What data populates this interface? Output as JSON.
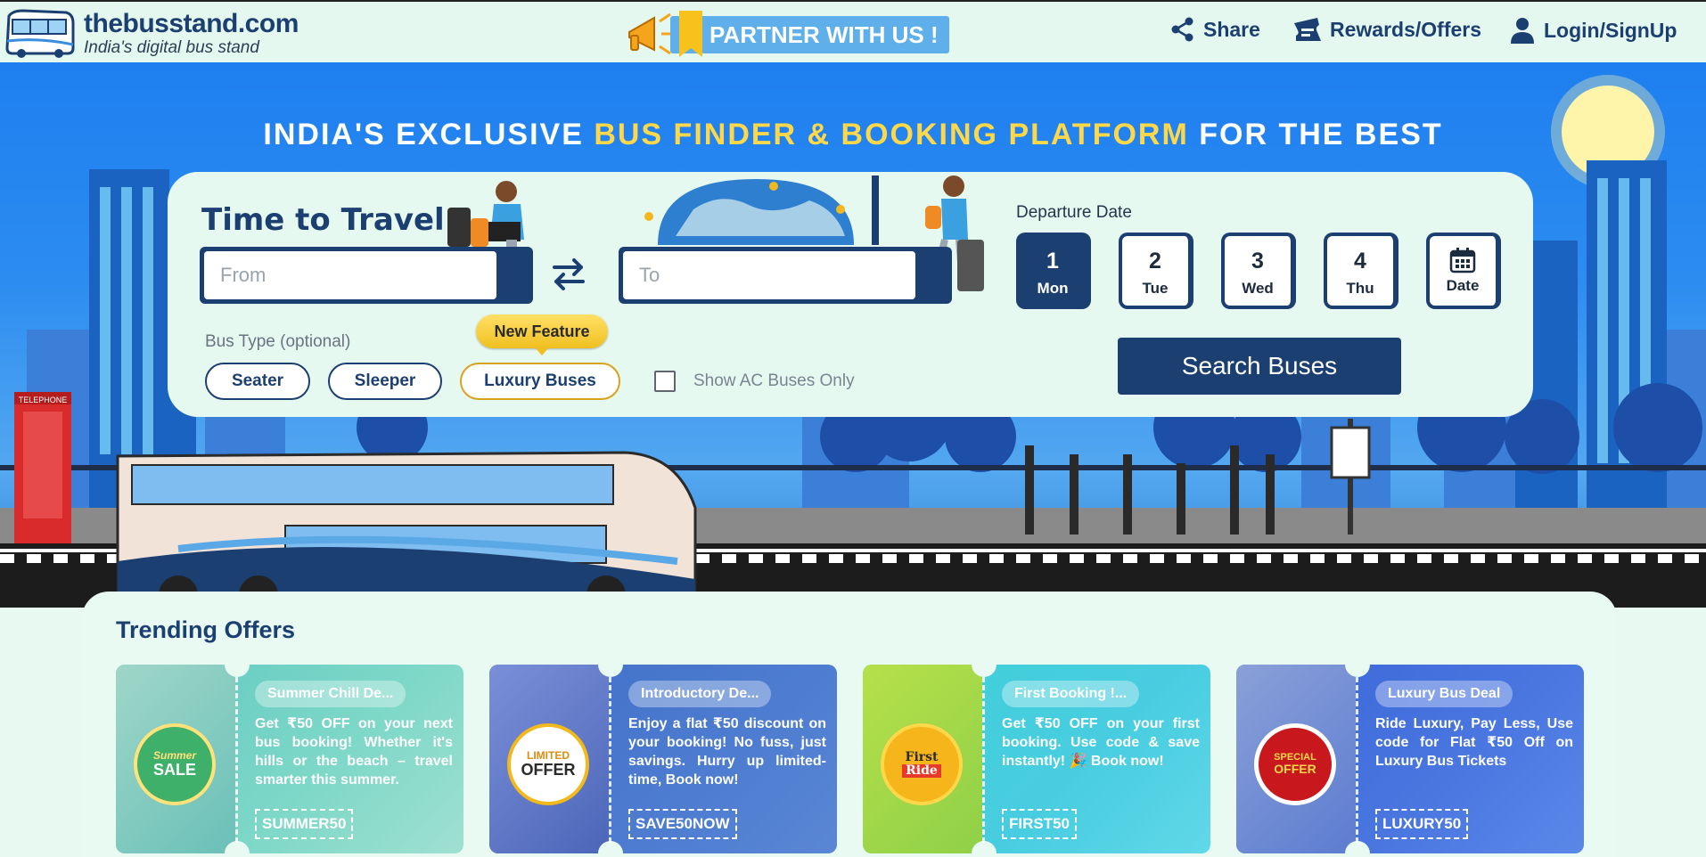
{
  "header": {
    "site_name": "thebusstand.com",
    "tagline": "India's digital bus stand",
    "partner_label": "PARTNER WITH US !",
    "nav": {
      "share": "Share",
      "rewards": "Rewards/Offers",
      "login": "Login/SignUp"
    }
  },
  "hero": {
    "headline_part1": "INDIA'S EXCLUSIVE ",
    "headline_highlight": "BUS FINDER & BOOKING PLATFORM",
    "headline_part2": " FOR THE BEST"
  },
  "search": {
    "heading": "Time to Travel",
    "from_placeholder": "From",
    "to_placeholder": "To",
    "departure_label": "Departure Date",
    "dates": [
      {
        "num": "1",
        "day": "Mon",
        "selected": true
      },
      {
        "num": "2",
        "day": "Tue",
        "selected": false
      },
      {
        "num": "3",
        "day": "Wed",
        "selected": false
      },
      {
        "num": "4",
        "day": "Thu",
        "selected": false
      }
    ],
    "date_picker_label": "Date",
    "bus_type_label": "Bus Type (optional)",
    "bus_types": [
      "Seater",
      "Sleeper",
      "Luxury Buses"
    ],
    "new_feature_badge": "New Feature",
    "ac_only_label": "Show AC Buses Only",
    "ac_only_checked": false,
    "search_button": "Search Buses"
  },
  "offers": {
    "title": "Trending Offers",
    "items": [
      {
        "title": "Summer Chill De...",
        "description": "Get ₹50 OFF on your next bus booking! Whether it's hills or the beach – travel smarter this summer.",
        "code": "SUMMER50",
        "badge": "SALE",
        "badge_top": "Summer"
      },
      {
        "title": "Introductory De...",
        "description": "Enjoy a flat ₹50 discount on your booking! No fuss, just savings. Hurry up limited-time, Book now!",
        "code": "SAVE50NOW",
        "badge": "OFFER",
        "badge_top": "LIMITED"
      },
      {
        "title": "First Booking !...",
        "description": "Get ₹50 OFF on your first booking. Use code & save instantly! 🎉 Book now!",
        "code": "FIRST50",
        "badge": "Ride",
        "badge_top": "First"
      },
      {
        "title": "Luxury Bus Deal",
        "description": "Ride Luxury, Pay Less, Use code for Flat ₹50 Off on Luxury Bus Tickets",
        "code": "LUXURY50",
        "badge": "OFFER",
        "badge_top": "SPECIAL"
      }
    ]
  },
  "colors": {
    "brand_navy": "#1c3f72",
    "highlight_yellow": "#ffd84a",
    "page_mint": "#e7f9f1"
  }
}
